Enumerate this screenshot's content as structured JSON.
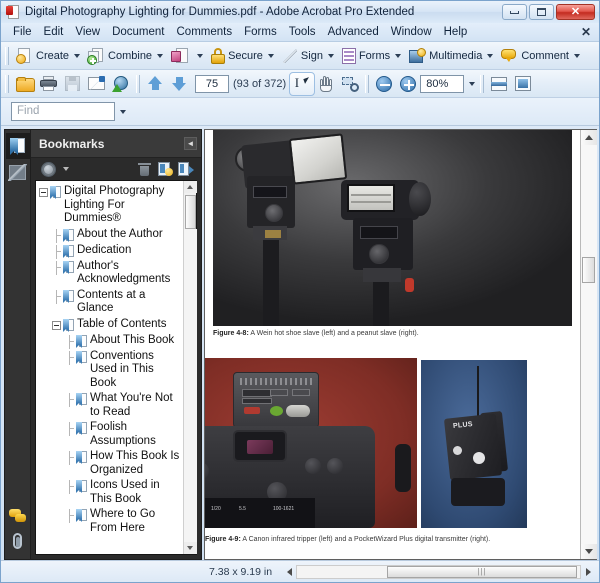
{
  "window": {
    "title": "Digital Photography Lighting for Dummies.pdf - Adobe Acrobat Pro Extended",
    "minimize_label": "Minimize",
    "maximize_label": "Maximize",
    "close_label": "Close"
  },
  "menubar": {
    "items": [
      {
        "label": "File"
      },
      {
        "label": "Edit"
      },
      {
        "label": "View"
      },
      {
        "label": "Document"
      },
      {
        "label": "Comments"
      },
      {
        "label": "Forms"
      },
      {
        "label": "Tools"
      },
      {
        "label": "Advanced"
      },
      {
        "label": "Window"
      },
      {
        "label": "Help"
      }
    ],
    "close_document": "✕"
  },
  "tasks_toolbar": {
    "buttons": [
      {
        "label": "Create",
        "icon": "create-pdf-icon"
      },
      {
        "label": "Combine",
        "icon": "combine-files-icon"
      },
      {
        "label": "",
        "icon": "export-pdf-icon"
      },
      {
        "label": "Secure",
        "icon": "padlock-icon"
      },
      {
        "label": "Sign",
        "icon": "pen-icon"
      },
      {
        "label": "Forms",
        "icon": "forms-icon"
      },
      {
        "label": "Multimedia",
        "icon": "multimedia-icon"
      },
      {
        "label": "Comment",
        "icon": "comment-balloon-icon"
      }
    ]
  },
  "nav_toolbar": {
    "open_label": "Open",
    "print_label": "Print",
    "save_label": "Save",
    "email_label": "Email",
    "web_label": "Upload to Acrobat.com",
    "prev_page_label": "Previous Page",
    "next_page_label": "Next Page",
    "page_number": "75",
    "page_count": "(93 of 372)",
    "select_tool_label": "Select Tool",
    "hand_tool_label": "Hand Tool",
    "marquee_zoom_label": "Marquee Zoom",
    "zoom_out_label": "Zoom Out",
    "zoom_in_label": "Zoom In",
    "zoom_level": "80%",
    "fit_width_label": "Fit Width",
    "fit_page_label": "Fit Page"
  },
  "find_bar": {
    "placeholder": "Find",
    "value": "",
    "dropdown_label": "Find Options"
  },
  "nav_strip": {
    "items": [
      {
        "name": "bookmarks-panel-button",
        "icon": "bookmarks-icon",
        "selected": true
      },
      {
        "name": "signatures-panel-button",
        "icon": "signature-icon",
        "selected": false
      },
      {
        "name": "comments-panel-button",
        "icon": "comments-icon",
        "selected": false
      },
      {
        "name": "attachments-panel-button",
        "icon": "paperclip-icon",
        "selected": false
      }
    ]
  },
  "bookmarks_panel": {
    "title": "Bookmarks",
    "collapse_label": "◄",
    "tools": [
      {
        "name": "bookmark-options-button",
        "icon": "gear-icon"
      },
      {
        "name": "delete-bookmark-button",
        "icon": "trash-icon"
      },
      {
        "name": "expand-current-bookmark-button",
        "icon": "expand-bookmark-icon"
      },
      {
        "name": "new-bookmark-button",
        "icon": "new-bookmark-icon"
      }
    ],
    "items": [
      {
        "label": "Digital Photography Lighting For Dummies®",
        "level": 1,
        "twisty": "minus"
      },
      {
        "label": "About the Author",
        "level": 2,
        "twisty": "none"
      },
      {
        "label": "Dedication",
        "level": 2,
        "twisty": "none"
      },
      {
        "label": "Author's Acknowledgments",
        "level": 2,
        "twisty": "none"
      },
      {
        "label": "Contents at a Glance",
        "level": 2,
        "twisty": "none"
      },
      {
        "label": "Table of Contents",
        "level": 2,
        "twisty": "minus"
      },
      {
        "label": "About This Book",
        "level": 3,
        "twisty": "none"
      },
      {
        "label": "Conventions Used in This Book",
        "level": 3,
        "twisty": "none"
      },
      {
        "label": "What You're Not to Read",
        "level": 3,
        "twisty": "none"
      },
      {
        "label": "Foolish Assumptions",
        "level": 3,
        "twisty": "none"
      },
      {
        "label": "How This Book Is Organized",
        "level": 3,
        "twisty": "none"
      },
      {
        "label": "Icons Used in This Book",
        "level": 3,
        "twisty": "none"
      },
      {
        "label": "Where to Go From Here",
        "level": 3,
        "twisty": "none"
      }
    ]
  },
  "document": {
    "figure_1_caption_label": "Figure 4-8:",
    "figure_1_caption_text": " A Wein hot shoe slave (left) and a peanut slave (right).",
    "figure_2_caption_label": "Figure 4-9:",
    "figure_2_caption_text": " A Canon infrared tripper (left) and a PocketWizard Plus digital transmitter (right).",
    "pocketwizard_label": "PLUS"
  },
  "status_bar": {
    "page_dimensions": "7.38 x 9.19 in",
    "scroll_left_label": "◄",
    "scroll_right_label": "►",
    "grip": "|||"
  },
  "colors": {
    "accent": "#2d6da8",
    "chrome": "#d6e5f5",
    "panel_dark": "#2b2b2b",
    "close_red": "#c32b20"
  }
}
